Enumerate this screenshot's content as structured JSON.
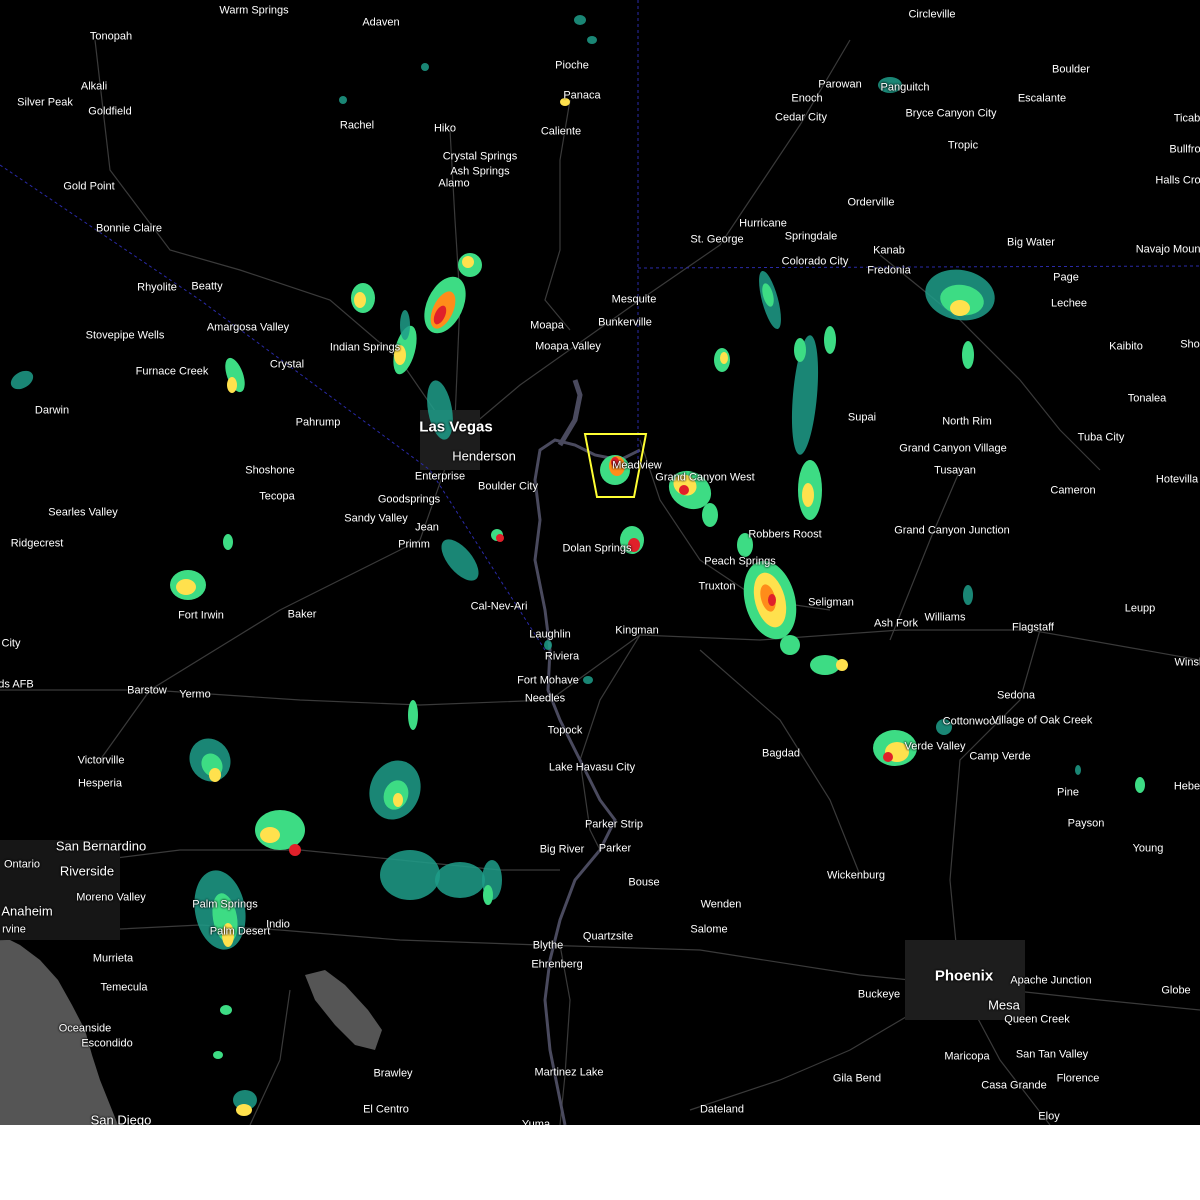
{
  "map": {
    "theme": "dark",
    "colors": {
      "background": "#000000",
      "land_ocean": "#555555",
      "roads": "#3a3a3a",
      "state_border": "#2a2aa8",
      "water": "#4a4a5e",
      "warning_polygon": "#ffff33",
      "radar_light": "#1f9e8a",
      "radar_moderate": "#3ddc84",
      "radar_heavy": "#ffe14d",
      "radar_intense": "#ff8c1a",
      "radar_extreme": "#e0202a"
    },
    "places": [
      {
        "name": "Warm Springs"
      },
      {
        "name": "Adaven"
      },
      {
        "name": "Tonopah"
      },
      {
        "name": "Alkali"
      },
      {
        "name": "Silver Peak"
      },
      {
        "name": "Goldfield"
      },
      {
        "name": "Rachel"
      },
      {
        "name": "Hiko"
      },
      {
        "name": "Crystal Springs"
      },
      {
        "name": "Ash Springs"
      },
      {
        "name": "Alamo"
      },
      {
        "name": "Pioche"
      },
      {
        "name": "Panaca"
      },
      {
        "name": "Caliente"
      },
      {
        "name": "Circleville"
      },
      {
        "name": "Parowan"
      },
      {
        "name": "Enoch"
      },
      {
        "name": "Cedar City"
      },
      {
        "name": "Panguitch"
      },
      {
        "name": "Bryce Canyon City"
      },
      {
        "name": "Tropic"
      },
      {
        "name": "Boulder"
      },
      {
        "name": "Escalante"
      },
      {
        "name": "Ticab"
      },
      {
        "name": "Bullfro"
      },
      {
        "name": "Halls Cro"
      },
      {
        "name": "Gold Point"
      },
      {
        "name": "Bonnie Claire"
      },
      {
        "name": "Rhyolite"
      },
      {
        "name": "Beatty"
      },
      {
        "name": "Amargosa Valley"
      },
      {
        "name": "Stovepipe Wells"
      },
      {
        "name": "Furnace Creek"
      },
      {
        "name": "Indian Springs"
      },
      {
        "name": "Crystal"
      },
      {
        "name": "Darwin"
      },
      {
        "name": "Pahrump"
      },
      {
        "name": "Las Vegas"
      },
      {
        "name": "Henderson"
      },
      {
        "name": "Enterprise"
      },
      {
        "name": "Boulder City"
      },
      {
        "name": "Shoshone"
      },
      {
        "name": "Tecopa"
      },
      {
        "name": "Goodsprings"
      },
      {
        "name": "Sandy Valley"
      },
      {
        "name": "Jean"
      },
      {
        "name": "Primm"
      },
      {
        "name": "Searles Valley"
      },
      {
        "name": "Ridgecrest"
      },
      {
        "name": "Moapa"
      },
      {
        "name": "Moapa Valley"
      },
      {
        "name": "Mesquite"
      },
      {
        "name": "Bunkerville"
      },
      {
        "name": "St. George"
      },
      {
        "name": "Hurricane"
      },
      {
        "name": "Springdale"
      },
      {
        "name": "Orderville"
      },
      {
        "name": "Kanab"
      },
      {
        "name": "Colorado City"
      },
      {
        "name": "Fredonia"
      },
      {
        "name": "Big Water"
      },
      {
        "name": "Page"
      },
      {
        "name": "Lechee"
      },
      {
        "name": "Navajo Mountain"
      },
      {
        "name": "Kaibito"
      },
      {
        "name": "Sho"
      },
      {
        "name": "Meadview"
      },
      {
        "name": "Grand Canyon West"
      },
      {
        "name": "Peach Springs"
      },
      {
        "name": "Supai"
      },
      {
        "name": "North Rim"
      },
      {
        "name": "Grand Canyon Village"
      },
      {
        "name": "Tusayan"
      },
      {
        "name": "Tuba City"
      },
      {
        "name": "Tonalea"
      },
      {
        "name": "Cameron"
      },
      {
        "name": "Hotevilla"
      },
      {
        "name": "Robbers Roost"
      },
      {
        "name": "Grand Canyon Junction"
      },
      {
        "name": "Dolan Springs"
      },
      {
        "name": "Truxton"
      },
      {
        "name": "Seligman"
      },
      {
        "name": "Ash Fork"
      },
      {
        "name": "Williams"
      },
      {
        "name": "Flagstaff"
      },
      {
        "name": "Leupp"
      },
      {
        "name": "Winsl"
      },
      {
        "name": "Fort Irwin"
      },
      {
        "name": "Baker"
      },
      {
        "name": "Cal-Nev-Ari"
      },
      {
        "name": "Laughlin"
      },
      {
        "name": "Riviera"
      },
      {
        "name": "Kingman"
      },
      {
        "name": "Fort Mohave"
      },
      {
        "name": "Needles"
      },
      {
        "name": "City"
      },
      {
        "name": "ds AFB"
      },
      {
        "name": "Barstow"
      },
      {
        "name": "Yermo"
      },
      {
        "name": "Topock"
      },
      {
        "name": "Lake Havasu City"
      },
      {
        "name": "Bagdad"
      },
      {
        "name": "Sedona"
      },
      {
        "name": "Cottonwood"
      },
      {
        "name": "Village of Oak Creek"
      },
      {
        "name": "Camp Verde"
      },
      {
        "name": "Verde Valley"
      },
      {
        "name": "Victorville"
      },
      {
        "name": "Hesperia"
      },
      {
        "name": "Parker Strip"
      },
      {
        "name": "Parker"
      },
      {
        "name": "Big River"
      },
      {
        "name": "Pine"
      },
      {
        "name": "Payson"
      },
      {
        "name": "Hebe"
      },
      {
        "name": "Young"
      },
      {
        "name": "San Bernardino"
      },
      {
        "name": "Ontario"
      },
      {
        "name": "Riverside"
      },
      {
        "name": "Moreno Valley"
      },
      {
        "name": "Anaheim"
      },
      {
        "name": "rvine"
      },
      {
        "name": "Palm Springs"
      },
      {
        "name": "Palm Desert"
      },
      {
        "name": "Indio"
      },
      {
        "name": "Bouse"
      },
      {
        "name": "Wenden"
      },
      {
        "name": "Salome"
      },
      {
        "name": "Wickenburg"
      },
      {
        "name": "Blythe"
      },
      {
        "name": "Ehrenberg"
      },
      {
        "name": "Quartzsite"
      },
      {
        "name": "Phoenix"
      },
      {
        "name": "Buckeye"
      },
      {
        "name": "Mesa"
      },
      {
        "name": "Apache Junction"
      },
      {
        "name": "Queen Creek"
      },
      {
        "name": "Globe"
      },
      {
        "name": "Murrieta"
      },
      {
        "name": "Temecula"
      },
      {
        "name": "San Tan Valley"
      },
      {
        "name": "Maricopa"
      },
      {
        "name": "Florence"
      },
      {
        "name": "Casa Grande"
      },
      {
        "name": "Oceanside"
      },
      {
        "name": "Escondido"
      },
      {
        "name": "Brawley"
      },
      {
        "name": "Martinez Lake"
      },
      {
        "name": "Gila Bend"
      },
      {
        "name": "El Centro"
      },
      {
        "name": "Dateland"
      },
      {
        "name": "Eloy"
      },
      {
        "name": "San Diego"
      },
      {
        "name": "Yuma"
      }
    ]
  }
}
